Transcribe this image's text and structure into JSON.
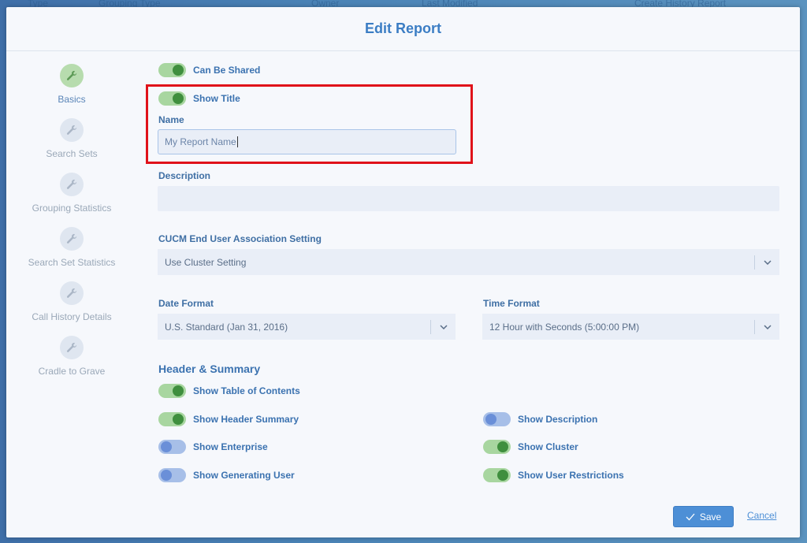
{
  "background": {
    "columns": [
      "Type",
      "Grouping Type",
      "Owner",
      "Last Modified",
      "Create History Report"
    ]
  },
  "modal": {
    "title": "Edit Report"
  },
  "steps": [
    {
      "label": "Basics",
      "active": true
    },
    {
      "label": "Search Sets",
      "active": false
    },
    {
      "label": "Grouping Statistics",
      "active": false
    },
    {
      "label": "Search Set Statistics",
      "active": false
    },
    {
      "label": "Call History Details",
      "active": false
    },
    {
      "label": "Cradle to Grave",
      "active": false
    }
  ],
  "toggles": {
    "can_be_shared": {
      "label": "Can Be Shared",
      "on": true
    },
    "show_title": {
      "label": "Show Title",
      "on": true
    },
    "show_toc": {
      "label": "Show Table of Contents",
      "on": true
    },
    "show_header_summary": {
      "label": "Show Header Summary",
      "on": true
    },
    "show_description": {
      "label": "Show Description",
      "on": false
    },
    "show_enterprise": {
      "label": "Show Enterprise",
      "on": false
    },
    "show_cluster": {
      "label": "Show Cluster",
      "on": true
    },
    "show_generating_user": {
      "label": "Show Generating User",
      "on": false
    },
    "show_user_restrictions": {
      "label": "Show User Restrictions",
      "on": true
    }
  },
  "fields": {
    "name": {
      "label": "Name",
      "value": "My Report Name"
    },
    "description": {
      "label": "Description",
      "value": ""
    },
    "cucm": {
      "label": "CUCM End User Association Setting",
      "value": "Use Cluster Setting"
    },
    "date_format": {
      "label": "Date Format",
      "value": "U.S. Standard (Jan 31, 2016)"
    },
    "time_format": {
      "label": "Time Format",
      "value": "12 Hour with Seconds (5:00:00 PM)"
    }
  },
  "sections": {
    "header_summary": "Header & Summary"
  },
  "actions": {
    "save": "Save",
    "cancel": "Cancel"
  },
  "colors": {
    "accent": "#3b7dc4",
    "toggle_on": "#3f8f3e",
    "toggle_off": "#6a8fd8",
    "highlight": "#e0121a"
  }
}
